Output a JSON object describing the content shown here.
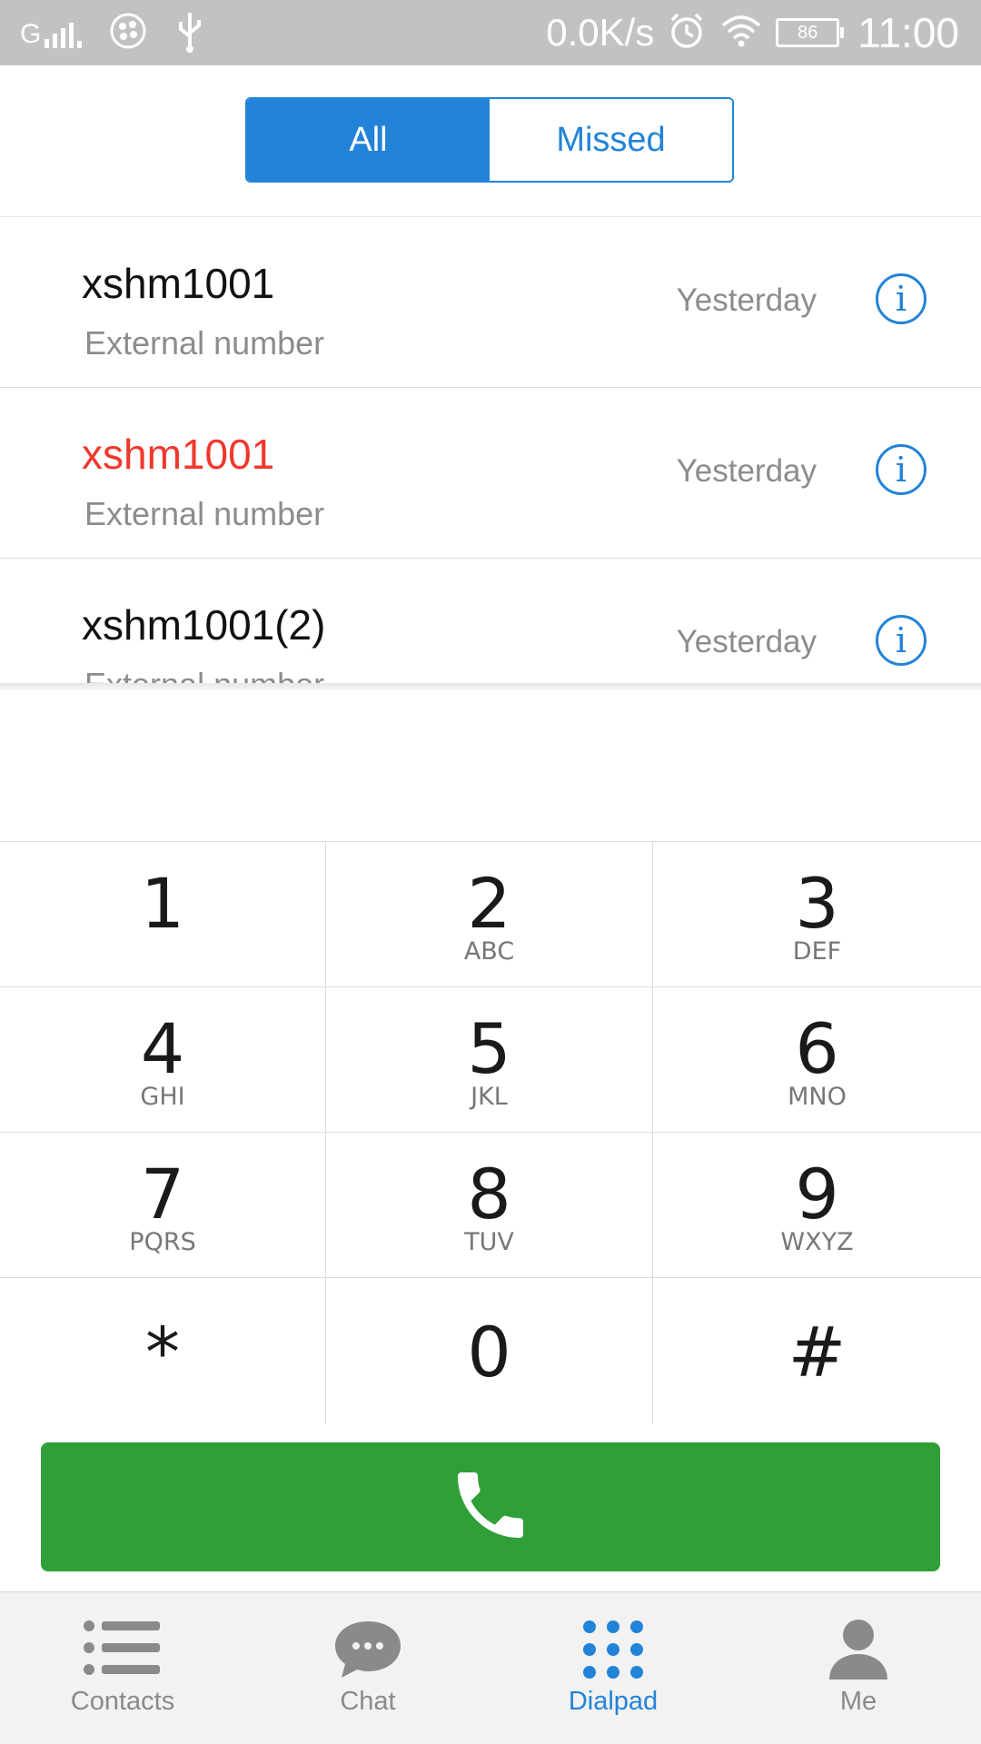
{
  "status_bar": {
    "signal_label": "G",
    "net_speed": "0.0K/s",
    "battery_level": "86",
    "time": "11:00",
    "icons": [
      "signal-icon",
      "clover-icon",
      "usb-icon",
      "alarm-icon",
      "wifi-icon",
      "battery-icon"
    ]
  },
  "segment": {
    "all_label": "All",
    "missed_label": "Missed",
    "active": "All"
  },
  "calls": [
    {
      "name": "xshm1001",
      "subtitle": "External number",
      "time": "Yesterday",
      "missed": false
    },
    {
      "name": "xshm1001",
      "subtitle": "External number",
      "time": "Yesterday",
      "missed": true
    },
    {
      "name": "xshm1001(2)",
      "subtitle": "External number",
      "time": "Yesterday",
      "missed": false
    }
  ],
  "info_glyph": "i",
  "keypad": [
    {
      "digit": "1",
      "letters": ""
    },
    {
      "digit": "2",
      "letters": "ABC"
    },
    {
      "digit": "3",
      "letters": "DEF"
    },
    {
      "digit": "4",
      "letters": "GHI"
    },
    {
      "digit": "5",
      "letters": "JKL"
    },
    {
      "digit": "6",
      "letters": "MNO"
    },
    {
      "digit": "7",
      "letters": "PQRS"
    },
    {
      "digit": "8",
      "letters": "TUV"
    },
    {
      "digit": "9",
      "letters": "WXYZ"
    },
    {
      "digit": "*",
      "letters": ""
    },
    {
      "digit": "0",
      "letters": ""
    },
    {
      "digit": "#",
      "letters": ""
    }
  ],
  "call_button": {
    "icon": "phone-icon",
    "color": "#2f9f38"
  },
  "bottom_nav": [
    {
      "label": "Contacts",
      "icon": "contacts-list-icon",
      "active": false
    },
    {
      "label": "Chat",
      "icon": "chat-bubble-icon",
      "active": false
    },
    {
      "label": "Dialpad",
      "icon": "dialpad-icon",
      "active": true
    },
    {
      "label": "Me",
      "icon": "person-icon",
      "active": false
    }
  ],
  "colors": {
    "accent": "#2283d8",
    "missed": "#f0382c",
    "call_green": "#2f9f38",
    "status_bar": "#c2c2c2"
  }
}
